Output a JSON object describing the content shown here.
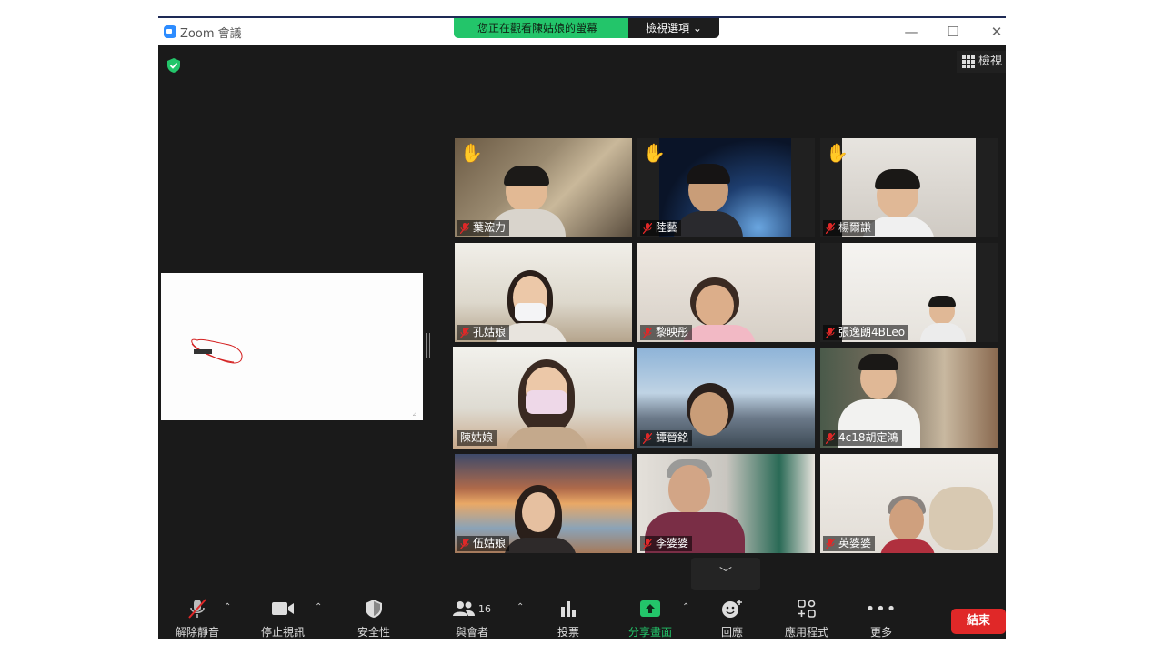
{
  "window": {
    "app_title": "Zoom 會議"
  },
  "share_banner": {
    "message": "您正在觀看陳姑娘的螢幕",
    "options_label": "檢視選項 ⌄"
  },
  "view_button": {
    "label": "檢視"
  },
  "participants": [
    {
      "name": "葉浤力",
      "muted": true,
      "hand_raised": true
    },
    {
      "name": "陸藝",
      "muted": true,
      "hand_raised": true
    },
    {
      "name": "楊爾謙",
      "muted": true,
      "hand_raised": true
    },
    {
      "name": "孔姑娘",
      "muted": true,
      "hand_raised": false
    },
    {
      "name": "黎映彤",
      "muted": true,
      "hand_raised": false
    },
    {
      "name": "張逸朗4BLeo",
      "muted": true,
      "hand_raised": false
    },
    {
      "name": "陳姑娘",
      "muted": false,
      "hand_raised": false,
      "active_speaker": true
    },
    {
      "name": "譚晉銘",
      "muted": true,
      "hand_raised": false
    },
    {
      "name": "4c18胡定鴻",
      "muted": true,
      "hand_raised": false
    },
    {
      "name": "伍姑娘",
      "muted": true,
      "hand_raised": false
    },
    {
      "name": "李婆婆",
      "muted": true,
      "hand_raised": false
    },
    {
      "name": "英婆婆",
      "muted": true,
      "hand_raised": false
    }
  ],
  "toolbar": {
    "unmute": "解除靜音",
    "stop_video": "停止視訊",
    "security": "安全性",
    "participants": "與會者",
    "participant_count": "16",
    "polls": "投票",
    "share_screen": "分享畫面",
    "reactions": "回應",
    "apps": "應用程式",
    "more": "更多",
    "end": "結束"
  },
  "colors": {
    "share_green": "#23c56a",
    "end_red": "#e02828",
    "active_speaker": "#c8e04a",
    "window_dark": "#1a1a1a"
  }
}
